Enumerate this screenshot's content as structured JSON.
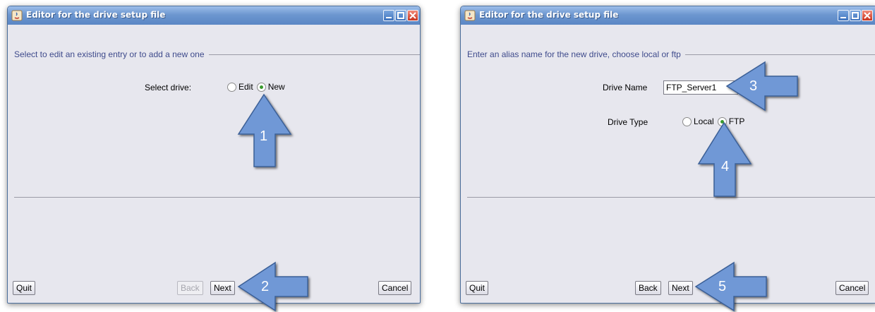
{
  "window_title": "Editor for the drive setup file",
  "left": {
    "section_label": "Select to edit an existing entry or to add a new one",
    "select_drive_label": "Select drive:",
    "option_edit": "Edit",
    "option_new": "New",
    "selected": "New",
    "quit": "Quit",
    "back": "Back",
    "back_enabled": false,
    "next": "Next",
    "cancel": "Cancel"
  },
  "right": {
    "section_label": "Enter an alias name for the new drive, choose local or ftp",
    "drive_name_label": "Drive Name",
    "drive_name_value": "FTP_Server1",
    "drive_type_label": "Drive Type",
    "option_local": "Local",
    "option_ftp": "FTP",
    "selected": "FTP",
    "quit": "Quit",
    "back": "Back",
    "back_enabled": true,
    "next": "Next",
    "cancel": "Cancel"
  },
  "callouts": [
    "1",
    "2",
    "3",
    "4",
    "5"
  ],
  "icons": [
    "java-app-icon",
    "minimize-icon",
    "maximize-icon",
    "close-icon"
  ],
  "colors": {
    "arrow_fill": "#6f98d6",
    "titlebar": "#6d97d0",
    "radio_selected": "#3a9a2e"
  }
}
